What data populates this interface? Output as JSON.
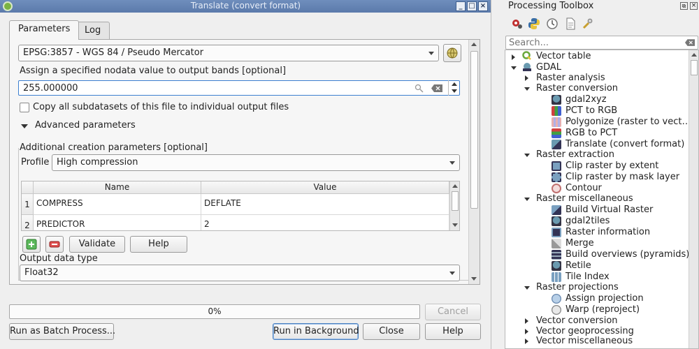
{
  "dialog": {
    "title": "Translate (convert format)",
    "window_buttons": [
      "_",
      "□",
      "×"
    ],
    "tabs": [
      {
        "label": "Parameters"
      },
      {
        "label": "Log"
      }
    ],
    "crs_value": "EPSG:3857 - WGS 84 / Pseudo Mercator",
    "nodata_label": "Assign a specified nodata value to output bands [optional]",
    "nodata_value": "255.000000",
    "copy_subdatasets_label": "Copy all subdatasets of this file to individual output files",
    "advanced_label": "Advanced parameters",
    "creation_params_label": "Additional creation parameters [optional]",
    "profile_label": "Profile",
    "profile_value": "High compression",
    "table": {
      "headers": [
        "Name",
        "Value"
      ],
      "rows": [
        {
          "num": "1",
          "name": "COMPRESS",
          "value": "DEFLATE"
        },
        {
          "num": "2",
          "name": "PREDICTOR",
          "value": "2"
        }
      ]
    },
    "validate_label": "Validate",
    "help_inner_label": "Help",
    "output_type_label": "Output data type",
    "output_type_value": "Float32",
    "progress_text": "0%",
    "progress": 0,
    "cancel_label": "Cancel",
    "batch_label": "Run as Batch Process...",
    "run_background_label": "Run in Background",
    "close_label": "Close",
    "help_label": "Help"
  },
  "toolbox": {
    "title": "Processing Toolbox",
    "search_placeholder": "Search...",
    "tree": [
      {
        "label": "Vector table"
      },
      {
        "label": "GDAL"
      },
      {
        "label": "Raster analysis"
      },
      {
        "label": "Raster conversion"
      },
      {
        "label": "gdal2xyz"
      },
      {
        "label": "PCT to RGB"
      },
      {
        "label": "Polygonize (raster to vect…"
      },
      {
        "label": "RGB to PCT"
      },
      {
        "label": "Translate (convert format)"
      },
      {
        "label": "Raster extraction"
      },
      {
        "label": "Clip raster by extent"
      },
      {
        "label": "Clip raster by mask layer"
      },
      {
        "label": "Contour"
      },
      {
        "label": "Raster miscellaneous"
      },
      {
        "label": "Build Virtual Raster"
      },
      {
        "label": "gdal2tiles"
      },
      {
        "label": "Raster information"
      },
      {
        "label": "Merge"
      },
      {
        "label": "Build overviews (pyramids)"
      },
      {
        "label": "Retile"
      },
      {
        "label": "Tile Index"
      },
      {
        "label": "Raster projections"
      },
      {
        "label": "Assign projection"
      },
      {
        "label": "Warp (reproject)"
      },
      {
        "label": "Vector conversion"
      },
      {
        "label": "Vector geoprocessing"
      },
      {
        "label": "Vector miscellaneous"
      }
    ]
  },
  "colors": {
    "titlebar": "#6384b4",
    "focus_border": "#3c7fd0",
    "accent_green": "#4ca64c",
    "remove_red": "#d04040"
  }
}
